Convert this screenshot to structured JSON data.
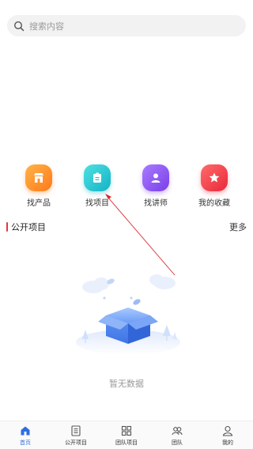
{
  "search": {
    "placeholder": "搜索内容",
    "icon": "search-icon"
  },
  "quick_actions": [
    {
      "label": "找产品",
      "icon": "shop-icon",
      "color": "#ff8f2a"
    },
    {
      "label": "找项目",
      "icon": "clipboard-icon",
      "color": "#1fc6cf"
    },
    {
      "label": "找讲师",
      "icon": "user-icon",
      "color": "#8b54f0"
    },
    {
      "label": "我的收藏",
      "icon": "star-icon",
      "color": "#f03c4a"
    }
  ],
  "section": {
    "title": "公开项目",
    "more": "更多",
    "accent": "#e8343a"
  },
  "empty_state": {
    "text": "暂无数据",
    "illustration": "empty-box-illustration"
  },
  "tabbar": {
    "active_color": "#2f6fe0",
    "items": [
      {
        "label": "首页",
        "icon": "home-icon",
        "active": true
      },
      {
        "label": "公开项目",
        "icon": "document-icon",
        "active": false
      },
      {
        "label": "团队项目",
        "icon": "grid-icon",
        "active": false
      },
      {
        "label": "团队",
        "icon": "group-icon",
        "active": false
      },
      {
        "label": "我的",
        "icon": "profile-icon",
        "active": false
      }
    ]
  }
}
